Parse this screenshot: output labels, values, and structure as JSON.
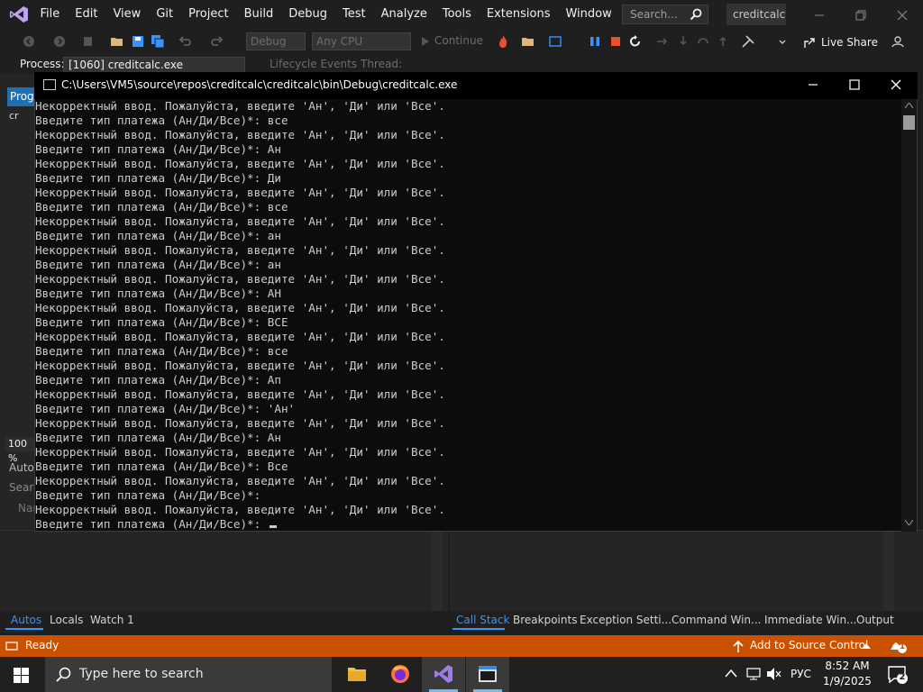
{
  "vs": {
    "menu": [
      "File",
      "Edit",
      "View",
      "Git",
      "Project",
      "Build",
      "Debug",
      "Test",
      "Analyze",
      "Tools",
      "Extensions",
      "Window",
      "Help"
    ],
    "search_placeholder": "Search...",
    "solution_name": "creditcalc",
    "toolbar": {
      "config": "Debug",
      "platform": "Any CPU",
      "continue": "Continue",
      "live_share": "Live Share"
    },
    "process_bar": {
      "label": "Process:",
      "process": "[1060] creditcalc.exe",
      "lifecycle": "Lifecycle Events",
      "thread": "Thread:"
    },
    "left": {
      "prog_tab": "Progr",
      "cs_item": "cr",
      "zoom": "100 %",
      "autos": "Autos",
      "search": "Searc",
      "name": "Nar"
    },
    "bottom_tabs_left": [
      "Autos",
      "Locals",
      "Watch 1"
    ],
    "bottom_tabs_right": [
      "Call Stack",
      "Breakpoints",
      "Exception Setti...",
      "Command Win...",
      "Immediate Win...",
      "Output"
    ],
    "status": {
      "ready": "Ready",
      "source_control": "Add to Source Control",
      "notifications": "1"
    }
  },
  "console": {
    "title": "C:\\Users\\VM5\\source\\repos\\creditcalc\\creditcalc\\bin\\Debug\\creditcalc.exe",
    "lines": [
      "Некорректный ввод. Пожалуйста, введите 'Ан', 'Ди' или 'Все'.",
      "Введите тип платежа (Ан/Ди/Все)*: все",
      "Некорректный ввод. Пожалуйста, введите 'Ан', 'Ди' или 'Все'.",
      "Введите тип платежа (Ан/Ди/Все)*: Ан",
      "Некорректный ввод. Пожалуйста, введите 'Ан', 'Ди' или 'Все'.",
      "Введите тип платежа (Ан/Ди/Все)*: Ди",
      "Некорректный ввод. Пожалуйста, введите 'Ан', 'Ди' или 'Все'.",
      "Введите тип платежа (Ан/Ди/Все)*: все",
      "Некорректный ввод. Пожалуйста, введите 'Ан', 'Ди' или 'Все'.",
      "Введите тип платежа (Ан/Ди/Все)*: ан",
      "Некорректный ввод. Пожалуйста, введите 'Ан', 'Ди' или 'Все'.",
      "Введите тип платежа (Ан/Ди/Все)*: ан",
      "Некорректный ввод. Пожалуйста, введите 'Ан', 'Ди' или 'Все'.",
      "Введите тип платежа (Ан/Ди/Все)*: АН",
      "Некорректный ввод. Пожалуйста, введите 'Ан', 'Ди' или 'Все'.",
      "Введите тип платежа (Ан/Ди/Все)*: ВСЕ",
      "Некорректный ввод. Пожалуйста, введите 'Ан', 'Ди' или 'Все'.",
      "Введите тип платежа (Ан/Ди/Все)*: все",
      "Некорректный ввод. Пожалуйста, введите 'Ан', 'Ди' или 'Все'.",
      "Введите тип платежа (Ан/Ди/Все)*: Ап",
      "Некорректный ввод. Пожалуйста, введите 'Ан', 'Ди' или 'Все'.",
      "Введите тип платежа (Ан/Ди/Все)*: 'Ан'",
      "Некорректный ввод. Пожалуйста, введите 'Ан', 'Ди' или 'Все'.",
      "Введите тип платежа (Ан/Ди/Все)*: Ан",
      "Некорректный ввод. Пожалуйста, введите 'Ан', 'Ди' или 'Все'.",
      "Введите тип платежа (Ан/Ди/Все)*: Все",
      "Некорректный ввод. Пожалуйста, введите 'Ан', 'Ди' или 'Все'.",
      "Введите тип платежа (Ан/Ди/Все)*:",
      "Некорректный ввод. Пожалуйста, введите 'Ан', 'Ди' или 'Все'.",
      "Введите тип платежа (Ан/Ди/Все)*: "
    ]
  },
  "taskbar": {
    "search_placeholder": "Type here to search",
    "language": "РУС",
    "time": "8:52 AM",
    "date": "1/9/2025",
    "notification_count": "2"
  },
  "colors": {
    "status_bar": "#ca5100",
    "accent": "#3794ff",
    "console_bg": "#0c0c0c"
  }
}
